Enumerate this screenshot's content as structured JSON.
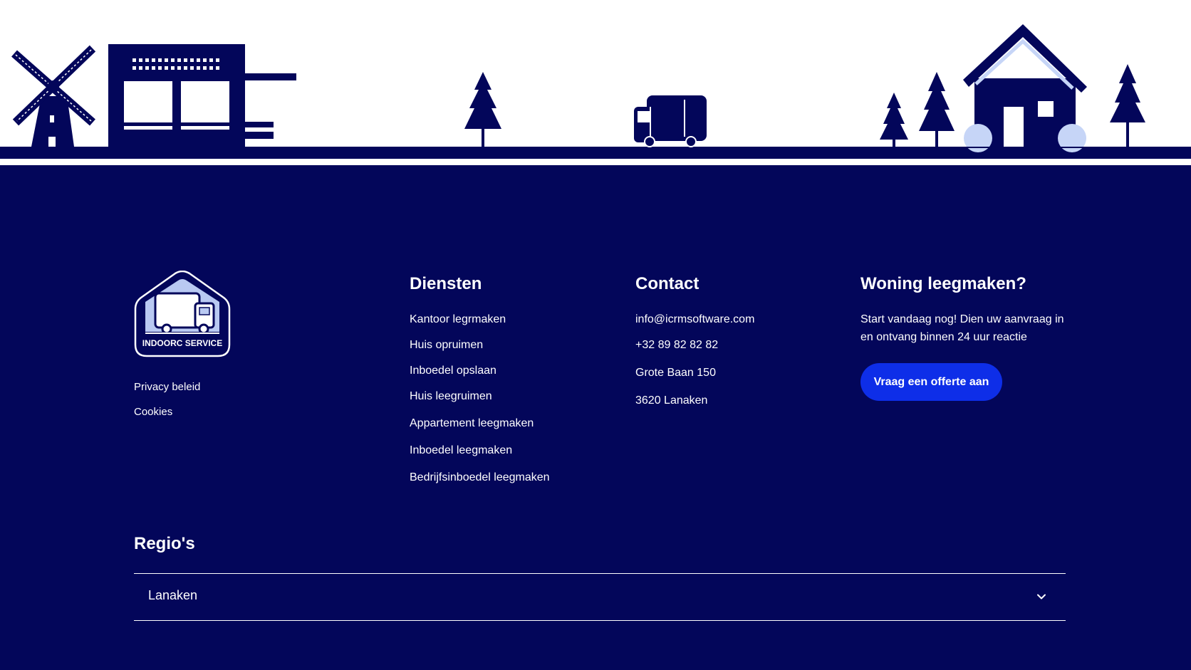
{
  "scene": {
    "navy": "#03065a",
    "light_blue": "#c6d5f7",
    "illustration": [
      "windmill",
      "warehouse",
      "tree",
      "moving-truck",
      "trees",
      "house"
    ]
  },
  "brand": {
    "logo_text": "INDOORC SERVICE"
  },
  "legal": {
    "privacy": "Privacy beleid",
    "cookies": "Cookies"
  },
  "services": {
    "title": "Diensten",
    "items": [
      "Kantoor legrmaken",
      "Huis opruimen",
      "Inboedel opslaan",
      "Huis leegruimen",
      "Appartement leegmaken",
      "Inboedel leegmaken",
      "Bedrijfsinboedel leegmaken"
    ]
  },
  "contact": {
    "title": "Contact",
    "email": "info@icrmsoftware.com",
    "phone": "+32 89 82 82 82",
    "street": "Grote Baan 150",
    "city": "3620 Lanaken"
  },
  "cta": {
    "title": "Woning leegmaken?",
    "text": "Start vandaag nog! Dien uw aanvraag in en ontvang binnen 24 uur reactie",
    "button": "Vraag een offerte aan",
    "button_color": "#0e2ee8"
  },
  "regions": {
    "title": "Regio's",
    "selected": "Lanaken",
    "icon": "chevron-down-icon"
  },
  "colors": {
    "footer_bg": "#03065a",
    "text": "#ffffff"
  }
}
